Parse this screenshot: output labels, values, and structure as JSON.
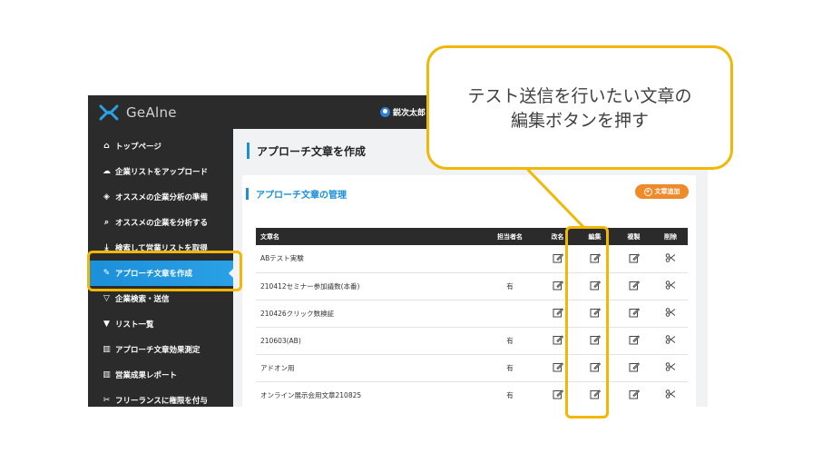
{
  "app": {
    "logo_text": "GeAlne",
    "user_name": "鋭次太郎"
  },
  "sidebar": {
    "items": [
      {
        "label": "トップページ",
        "icon": "home-icon",
        "glyph": "⌂",
        "active": false
      },
      {
        "label": "企業リストをアップロード",
        "icon": "cloud-upload-icon",
        "glyph": "☁",
        "active": false
      },
      {
        "label": "オススメの企業分析の準備",
        "icon": "layers-icon",
        "glyph": "◈",
        "active": false
      },
      {
        "label": "オススメの企業を分析する",
        "icon": "search-icon",
        "glyph": "⌕",
        "active": false
      },
      {
        "label": "検索して営業リストを取得",
        "icon": "download-icon",
        "glyph": "⤓",
        "active": false
      },
      {
        "label": "アプローチ文章を作成",
        "icon": "pencil-icon",
        "glyph": "✎",
        "active": true
      },
      {
        "label": "企業検索・送信",
        "icon": "filter-icon",
        "glyph": "▽",
        "active": false
      },
      {
        "label": "リスト一覧",
        "icon": "funnel-icon",
        "glyph": "▼",
        "active": false
      },
      {
        "label": "アプローチ文章効果測定",
        "icon": "bar-chart-icon",
        "glyph": "▥",
        "active": false
      },
      {
        "label": "営業成果レポート",
        "icon": "report-chart-icon",
        "glyph": "▥",
        "active": false
      },
      {
        "label": "フリーランスに権限を付与",
        "icon": "tools-icon",
        "glyph": "✂",
        "active": false
      }
    ]
  },
  "page": {
    "title": "アプローチ文章を作成"
  },
  "section": {
    "title": "アプローチ文章の管理",
    "add_button": "文章追加"
  },
  "table": {
    "headers": {
      "name": "文章名",
      "owner": "担当者名",
      "rename": "改名",
      "edit": "編集",
      "copy": "複製",
      "delete": "削除"
    },
    "rows": [
      {
        "name": "ABテスト実験",
        "owner": ""
      },
      {
        "name": "210412セミナー参加議数(本番)",
        "owner": "有"
      },
      {
        "name": "210426クリック数検証",
        "owner": ""
      },
      {
        "name": "210603(AB)",
        "owner": "有"
      },
      {
        "name": "アドオン用",
        "owner": "有"
      },
      {
        "name": "オンライン展示会用文章210825",
        "owner": "有"
      }
    ]
  },
  "callout": {
    "text": "テスト送信を行いたい文章の\n編集ボタンを押す"
  },
  "colors": {
    "accent": "#1b8fd8",
    "highlight": "#f2b705",
    "add_button": "#ee8a2a",
    "dark": "#2b2b2b"
  }
}
